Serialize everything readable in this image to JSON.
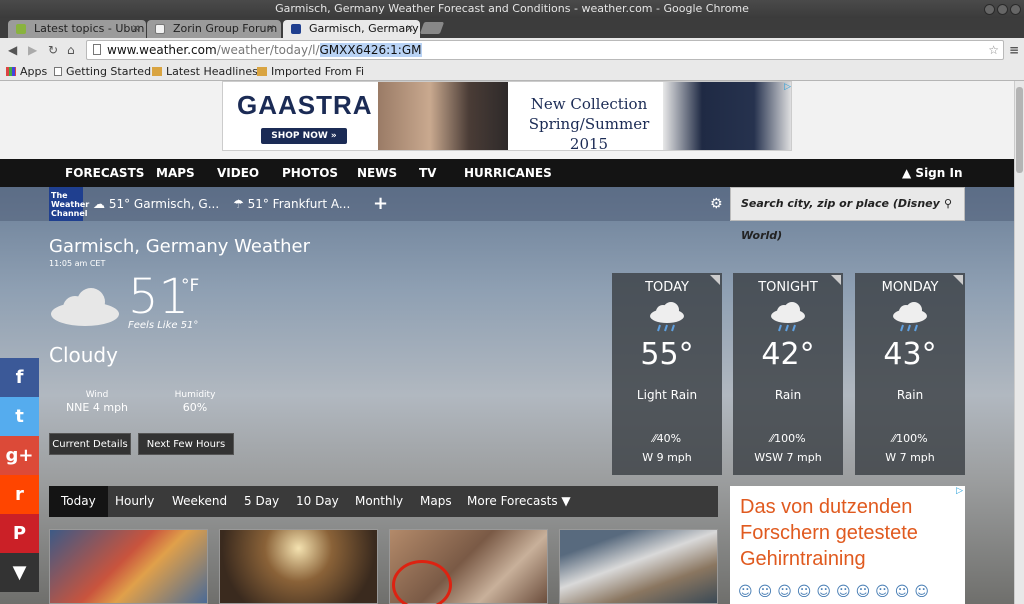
{
  "window": {
    "title": "Garmisch, Germany Weather Forecast and Conditions - weather.com - Google Chrome"
  },
  "tabs": [
    {
      "label": "Latest topics - Ubun",
      "close": "×"
    },
    {
      "label": "Zorin Group Forum",
      "close": "×"
    },
    {
      "label": "Garmisch, Germany",
      "close": "×"
    }
  ],
  "omnibox": {
    "url_host": "www.weather.com",
    "url_path": "/weather/today/l/",
    "url_selected": "GMXX6426:1:GM"
  },
  "bookmarks": [
    "Apps",
    "Getting Started",
    "Latest Headlines",
    "Imported From Fi"
  ],
  "ad_top": {
    "brand": "GAASTRA",
    "shop": "SHOP NOW »",
    "line1": "New Collection",
    "line2": "Spring/Summer 2015"
  },
  "nav": {
    "items": [
      "FORECASTS",
      "MAPS",
      "VIDEO",
      "PHOTOS",
      "NEWS",
      "TV",
      "HURRICANES"
    ],
    "signin": "Sign In"
  },
  "strip": {
    "logo": "The Weather Channel",
    "loc1": "51° Garmisch, G...",
    "loc2": "51° Frankfurt A...",
    "add": "+",
    "search_placeholder": "Search city, zip or place (Disney World)"
  },
  "current": {
    "city": "Garmisch, Germany Weather",
    "time": "11:05 am CET",
    "temp": "51",
    "unit": "°F",
    "feels": "Feels Like 51°",
    "condition": "Cloudy",
    "wind_label": "Wind",
    "wind_value": "NNE 4 mph",
    "humidity_label": "Humidity",
    "humidity_value": "60%",
    "btn_details": "Current Details",
    "btn_hours": "Next Few Hours"
  },
  "forecast": [
    {
      "head": "TODAY",
      "temp": "55°",
      "cond": "Light Rain",
      "precip": "40%",
      "wind": "W 9 mph"
    },
    {
      "head": "TONIGHT",
      "temp": "42°",
      "cond": "Rain",
      "precip": "100%",
      "wind": "WSW 7 mph"
    },
    {
      "head": "MONDAY",
      "temp": "43°",
      "cond": "Rain",
      "precip": "100%",
      "wind": "W 7 mph"
    }
  ],
  "subtabs": [
    "Today",
    "Hourly",
    "Weekend",
    "5 Day",
    "10 Day",
    "Monthly",
    "Maps",
    "More Forecasts"
  ],
  "ad_right": {
    "text": "Das von dutzenden Forschern getestete Gehirntraining"
  },
  "social": [
    "f",
    "t",
    "g+",
    "r",
    "P",
    "▼"
  ]
}
